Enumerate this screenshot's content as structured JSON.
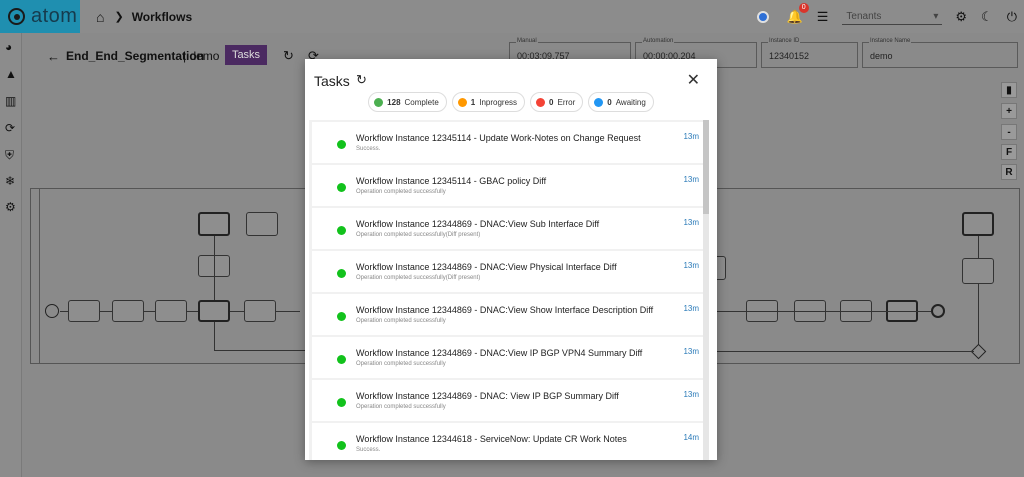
{
  "app": {
    "logo_text": "atom"
  },
  "breadcrumb": {
    "current": "Workflows"
  },
  "header": {
    "notification_count": "0",
    "tenant_placeholder": "Tenants"
  },
  "workflow": {
    "name": "End_End_Segmentation",
    "separator": "| demo",
    "tasks_button": "Tasks"
  },
  "fields": [
    {
      "label": "Manual",
      "value": "00:03:09.757"
    },
    {
      "label": "Automation",
      "value": "00:00:00.204"
    },
    {
      "label": "Instance ID",
      "value": "12340152"
    },
    {
      "label": "Instance Name",
      "value": "demo"
    }
  ],
  "zoom_controls": [
    "+",
    "-",
    "F",
    "R"
  ],
  "modal": {
    "title": "Tasks",
    "chips": [
      {
        "count": "128",
        "label": "Complete",
        "color": "#4caf50"
      },
      {
        "count": "1",
        "label": "Inprogress",
        "color": "#ff9800"
      },
      {
        "count": "0",
        "label": "Error",
        "color": "#f44336"
      },
      {
        "count": "0",
        "label": "Awaiting",
        "color": "#2196f3"
      }
    ],
    "tasks": [
      {
        "title": "Workflow Instance 12345114 - Update Work-Notes on Change Request",
        "status": "Success.",
        "time": "13m"
      },
      {
        "title": "Workflow Instance 12345114 - GBAC policy Diff",
        "status": "Operation completed successfully",
        "time": "13m"
      },
      {
        "title": "Workflow Instance 12344869 - DNAC:View Sub Interface Diff",
        "status": "Operation completed successfully(Diff present)",
        "time": "13m"
      },
      {
        "title": "Workflow Instance 12344869 - DNAC:View Physical Interface Diff",
        "status": "Operation completed successfully(Diff present)",
        "time": "13m"
      },
      {
        "title": "Workflow Instance 12344869 - DNAC:View Show Interface Description Diff",
        "status": "Operation completed successfully",
        "time": "13m"
      },
      {
        "title": "Workflow Instance 12344869 - DNAC:View IP BGP VPN4 Summary Diff",
        "status": "Operation completed successfully",
        "time": "13m"
      },
      {
        "title": "Workflow Instance 12344869 - DNAC: View IP BGP Summary Diff",
        "status": "Operation completed successfully",
        "time": "13m"
      },
      {
        "title": "Workflow Instance 12344618 - ServiceNow: Update CR Work Notes",
        "status": "Success.",
        "time": "14m"
      }
    ]
  }
}
